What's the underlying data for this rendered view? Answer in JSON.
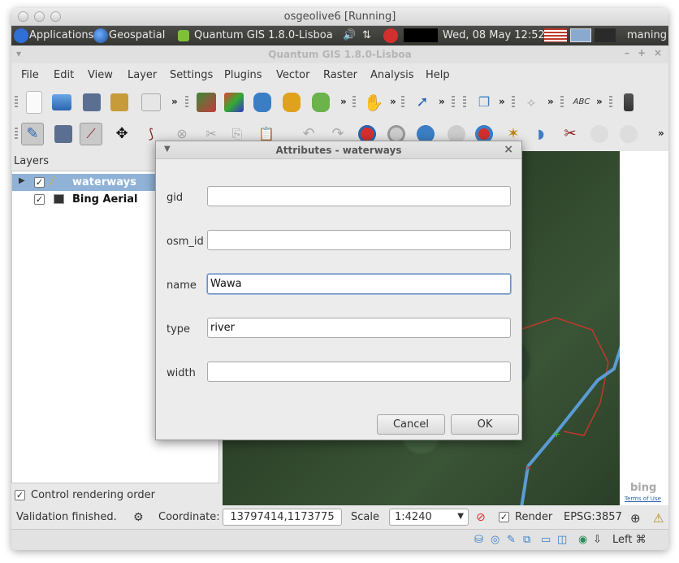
{
  "vm": {
    "title": "osgeolive6 [Running]"
  },
  "top_panel": {
    "applications": "Applications",
    "geospatial": "Geospatial",
    "qgis_task": "Quantum GIS 1.8.0-Lisboa",
    "datetime": "Wed, 08 May  12:52",
    "user": "maning"
  },
  "qgis": {
    "title": "Quantum GIS 1.8.0-Lisboa",
    "menu": [
      "File",
      "Edit",
      "View",
      "Layer",
      "Settings",
      "Plugins",
      "Vector",
      "Raster",
      "Analysis",
      "Help"
    ]
  },
  "layers_panel": {
    "header": "Layers",
    "layers": [
      {
        "name": "waterways",
        "checked": true,
        "selected": true
      },
      {
        "name": "Bing Aerial",
        "checked": true,
        "selected": false
      }
    ],
    "control_rendering_order": "Control rendering order"
  },
  "map": {
    "bing_logo": "bing",
    "terms": "Terms of Use",
    "colors": {
      "river": "#5b9bd5",
      "polygon": "#c0392b"
    }
  },
  "statusbar": {
    "message": "Validation finished.",
    "coordinate_label": "Coordinate:",
    "coordinate_value": "13797414,1173775",
    "scale_label": "Scale",
    "scale_value": "1:4240",
    "render_label": "Render",
    "epsg": "EPSG:3857"
  },
  "bottombar": {
    "keyboard": "Left ⌘"
  },
  "dialog": {
    "title": "Attributes - waterways",
    "fields": [
      {
        "label": "gid",
        "value": ""
      },
      {
        "label": "osm_id",
        "value": ""
      },
      {
        "label": "name",
        "value": "Wawa"
      },
      {
        "label": "type",
        "value": "river"
      },
      {
        "label": "width",
        "value": ""
      }
    ],
    "cancel_label": "Cancel",
    "ok_label": "OK"
  }
}
